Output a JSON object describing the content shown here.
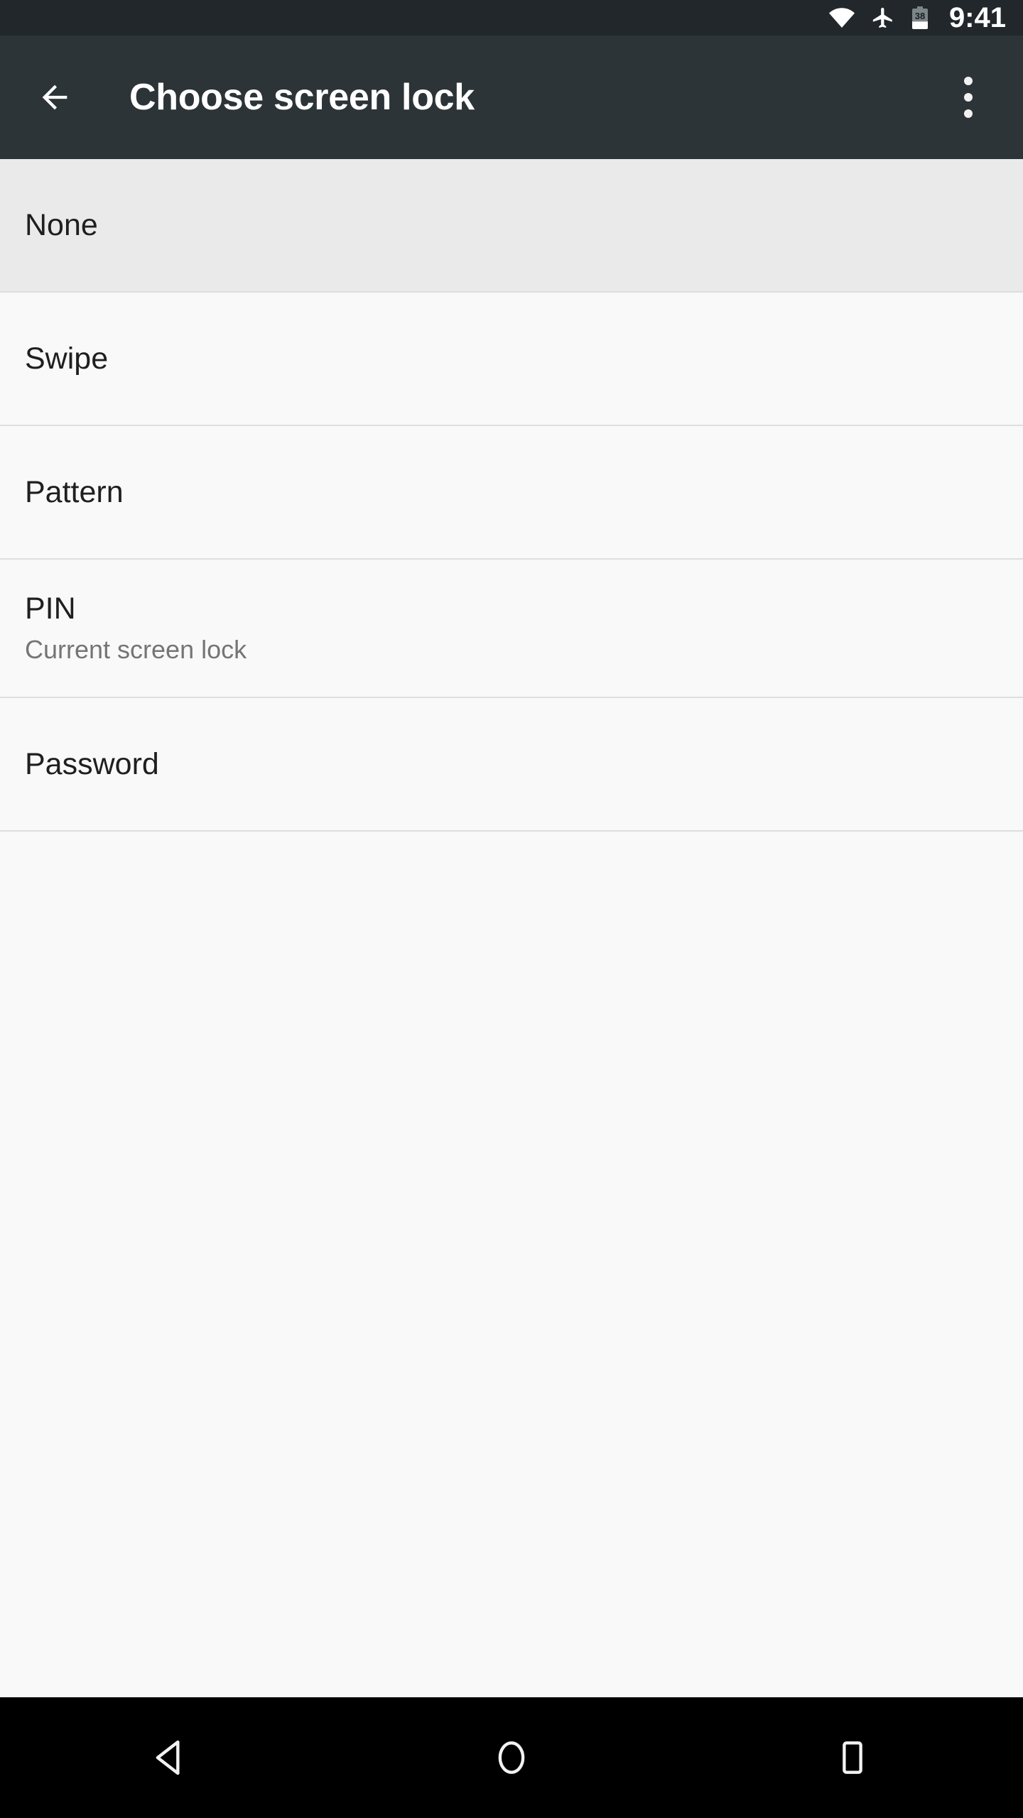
{
  "status_bar": {
    "time": "9:41",
    "icons": [
      {
        "name": "wifi-icon",
        "label": "wifi"
      },
      {
        "name": "airplane-mode-icon",
        "label": "airplane mode"
      },
      {
        "name": "battery-icon",
        "label": "battery"
      }
    ],
    "battery_level": "38",
    "battery_fill_percent": 38,
    "background_color": "#21272b",
    "foreground_color": "#ffffff"
  },
  "app_bar": {
    "title": "Choose screen lock",
    "back_icon": "arrow-back-icon",
    "overflow_icon": "more-vert-icon",
    "background_color": "#2c3438",
    "text_color": "#ffffff"
  },
  "list": {
    "selected_background": "#eaeaea",
    "row_background": "#f9f9f9",
    "divider_color": "#dedede",
    "title_color": "#1f1f1f",
    "subtitle_color": "#757575",
    "items": [
      {
        "title": "None",
        "subtitle": "",
        "selected": true
      },
      {
        "title": "Swipe",
        "subtitle": "",
        "selected": false
      },
      {
        "title": "Pattern",
        "subtitle": "",
        "selected": false
      },
      {
        "title": "PIN",
        "subtitle": "Current screen lock",
        "selected": false
      },
      {
        "title": "Password",
        "subtitle": "",
        "selected": false
      }
    ]
  },
  "nav_bar": {
    "background_color": "#000000",
    "buttons": [
      {
        "name": "nav-back-button",
        "label": "Back"
      },
      {
        "name": "nav-home-button",
        "label": "Home"
      },
      {
        "name": "nav-recents-button",
        "label": "Recents"
      }
    ]
  }
}
